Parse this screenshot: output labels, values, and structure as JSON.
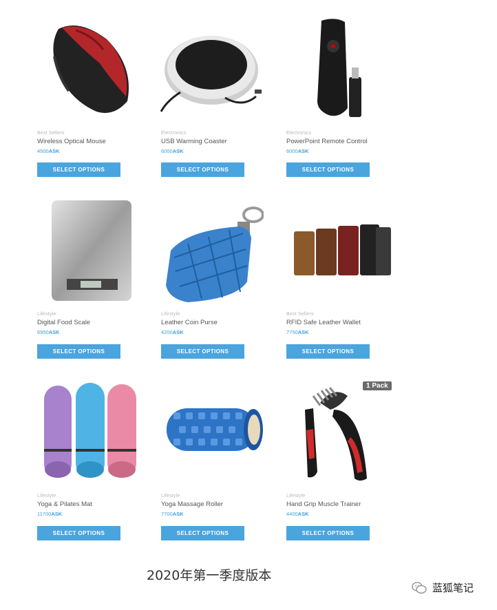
{
  "products": [
    {
      "category": "Best Sellers",
      "name": "Wireless Optical Mouse",
      "price": "4500",
      "currency": "ASK",
      "button": "SELECT OPTIONS"
    },
    {
      "category": "Electronics",
      "name": "USB Warming Coaster",
      "price": "6000",
      "currency": "ASK",
      "button": "SELECT OPTIONS"
    },
    {
      "category": "Electronics",
      "name": "PowerPoint Remote Control",
      "price": "6000",
      "currency": "ASK",
      "button": "SELECT OPTIONS"
    },
    {
      "category": "Lifestyle",
      "name": "Digital Food Scale",
      "price": "6950",
      "currency": "ASK",
      "button": "SELECT OPTIONS"
    },
    {
      "category": "Lifestyle",
      "name": "Leather Coin Purse",
      "price": "4200",
      "currency": "ASK",
      "button": "SELECT OPTIONS"
    },
    {
      "category": "Best Sellers",
      "name": "RFID Safe Leather Wallet",
      "price": "7750",
      "currency": "ASK",
      "button": "SELECT OPTIONS"
    },
    {
      "category": "Lifestyle",
      "name": "Yoga & Pilates Mat",
      "price": "11700",
      "currency": "ASK",
      "button": "SELECT OPTIONS"
    },
    {
      "category": "Lifestyle",
      "name": "Yoga Massage Roller",
      "price": "7700",
      "currency": "ASK",
      "button": "SELECT OPTIONS"
    },
    {
      "category": "Lifestyle",
      "name": "Hand Grip Muscle Trainer",
      "price": "4400",
      "currency": "ASK",
      "button": "SELECT OPTIONS"
    }
  ],
  "badge": "1 Pack",
  "caption": "2020年第一季度版本",
  "brand": "蓝狐笔记",
  "colors": {
    "button": "#4aa4de",
    "price": "#3aa0dc"
  }
}
